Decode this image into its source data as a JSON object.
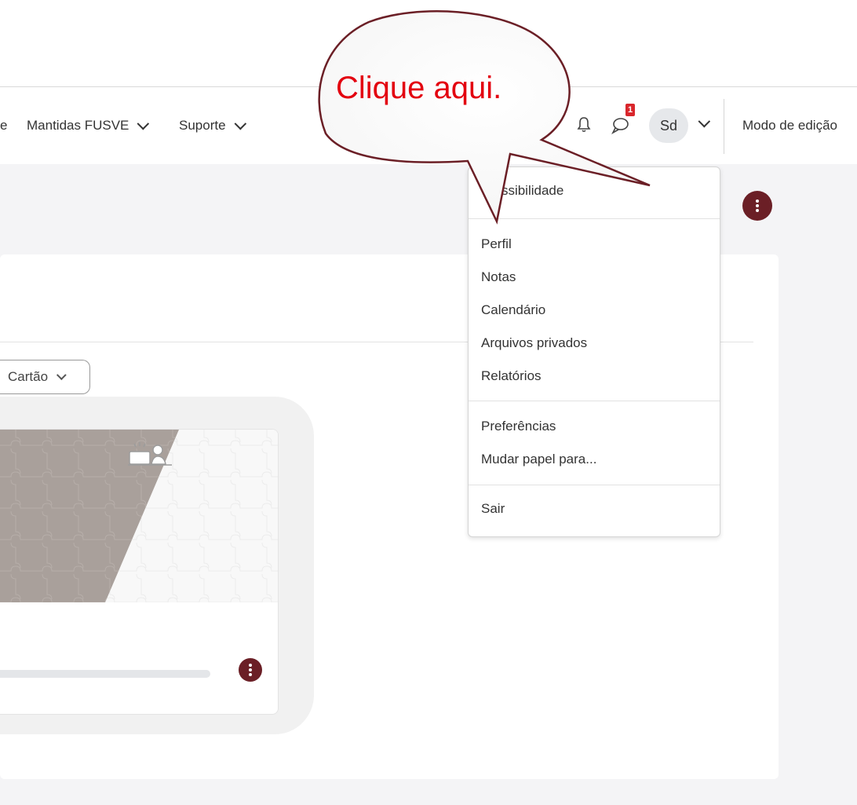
{
  "navbar": {
    "partial_item": "e",
    "menu_items": [
      {
        "label": "Mantidas FUSVE"
      },
      {
        "label": "Suporte"
      }
    ],
    "message_badge": "1",
    "avatar_initials": "Sd",
    "edit_mode_label": "Modo de edição"
  },
  "callout": {
    "text": "Clique aqui."
  },
  "user_menu": {
    "items": [
      {
        "label": "cessibilidade"
      },
      {
        "label": "Perfil"
      },
      {
        "label": "Notas"
      },
      {
        "label": "Calendário"
      },
      {
        "label": "Arquivos privados"
      },
      {
        "label": "Relatórios"
      },
      {
        "label": "Preferências"
      },
      {
        "label": "Mudar papel para..."
      },
      {
        "label": "Sair"
      }
    ]
  },
  "content": {
    "view_select": "Cartão"
  },
  "colors": {
    "accent": "#6b1f26",
    "callout_text": "#e3000f",
    "badge": "#d9262c"
  }
}
